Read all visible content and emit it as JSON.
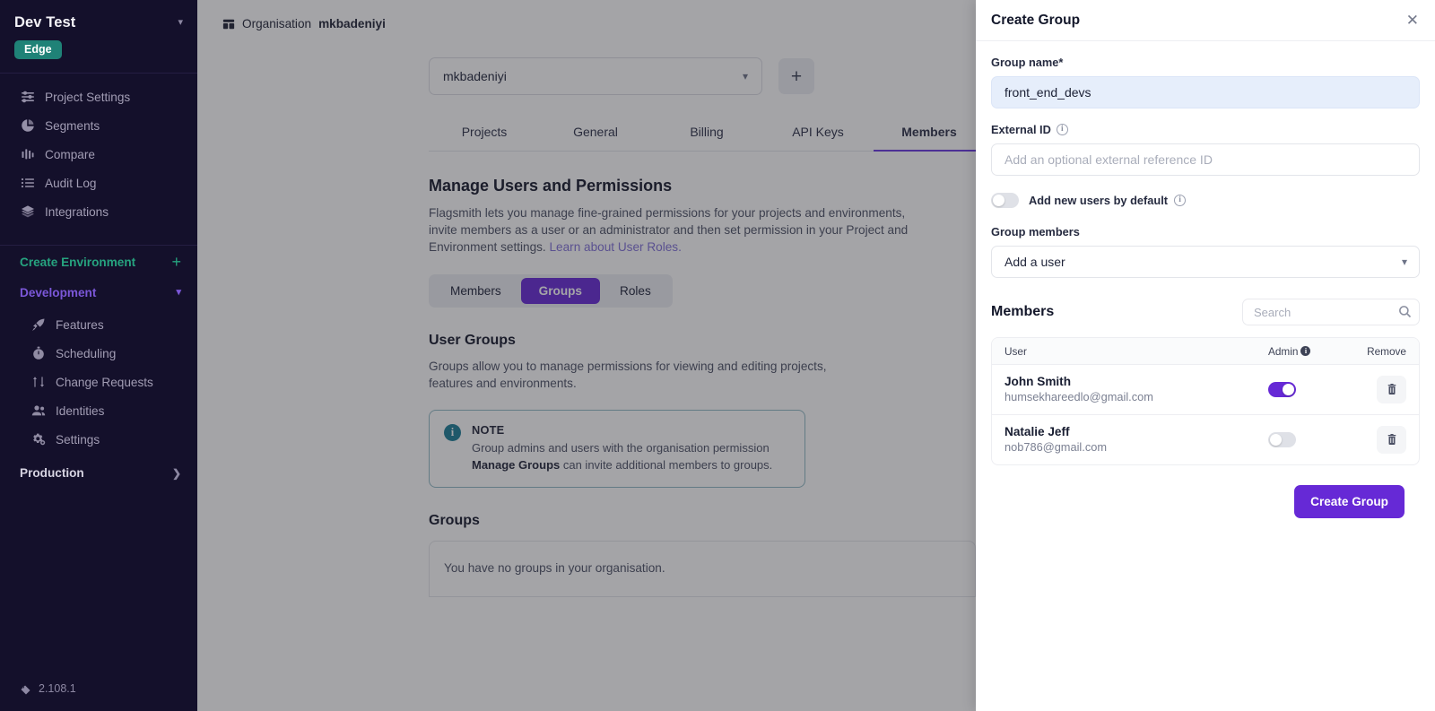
{
  "sidebar": {
    "project_name": "Dev Test",
    "project_chevron": "chevron-down",
    "edge_badge": "Edge",
    "project_items": [
      {
        "label": "Project Settings",
        "icon": "sliders-icon"
      },
      {
        "label": "Segments",
        "icon": "pie-chart-icon"
      },
      {
        "label": "Compare",
        "icon": "bar-chart-icon"
      },
      {
        "label": "Audit Log",
        "icon": "list-icon"
      },
      {
        "label": "Integrations",
        "icon": "layers-icon"
      }
    ],
    "create_environment": "Create Environment",
    "create_environment_plus": "+",
    "development": "Development",
    "development_items": [
      {
        "label": "Features",
        "icon": "rocket-icon"
      },
      {
        "label": "Scheduling",
        "icon": "stopwatch-icon"
      },
      {
        "label": "Change Requests",
        "icon": "git-branch-icon"
      },
      {
        "label": "Identities",
        "icon": "users-icon"
      },
      {
        "label": "Settings",
        "icon": "gears-icon"
      }
    ],
    "production": "Production",
    "version": "2.108.1"
  },
  "breadcrumb": {
    "icon": "organisation-icon",
    "prefix": "Organisation",
    "name": "mkbadeniyi"
  },
  "main": {
    "org_select_value": "mkbadeniyi",
    "org_add_label": "+",
    "tabs": [
      {
        "label": "Projects",
        "active": false
      },
      {
        "label": "General",
        "active": false
      },
      {
        "label": "Billing",
        "active": false
      },
      {
        "label": "API Keys",
        "active": false
      },
      {
        "label": "Members",
        "active": true
      }
    ],
    "manage_title": "Manage Users and Permissions",
    "manage_body_1": "Flagsmith lets you manage fine-grained permissions for your projects and environments, invite members as a user or an administrator and then set permission in your Project and Environment settings. ",
    "manage_link": "Learn about User Roles.",
    "segments": [
      {
        "label": "Members",
        "active": false
      },
      {
        "label": "Groups",
        "active": true
      },
      {
        "label": "Roles",
        "active": false
      }
    ],
    "user_groups_title": "User Groups",
    "user_groups_body": "Groups allow you to manage permissions for viewing and editing projects, features and environments.",
    "note": {
      "icon": "info-icon",
      "title": "NOTE",
      "body_1": "Group admins and users with the organisation permission ",
      "body_bold": "Manage Groups",
      "body_2": " can invite additional members to groups."
    },
    "groups_title": "Groups",
    "groups_empty": "You have no groups in your organisation."
  },
  "panel": {
    "title": "Create Group",
    "close_icon": "close-icon",
    "group_name_label": "Group name*",
    "group_name_value": "front_end_devs",
    "external_id_label": "External ID",
    "external_id_placeholder": "Add an optional external reference ID",
    "external_id_value": "",
    "add_new_users_label": "Add new users by default",
    "add_new_users_enabled": false,
    "group_members_label": "Group members",
    "add_user_select_value": "Add a user",
    "members_heading": "Members",
    "search_placeholder": "Search",
    "search_value": "",
    "table": {
      "columns": [
        "User",
        "Admin",
        "Remove"
      ],
      "rows": [
        {
          "name": "John Smith",
          "email": "humsekhareedlo@gmail.com",
          "admin": true,
          "remove_icon": "trash-icon"
        },
        {
          "name": "Natalie Jeff",
          "email": "nob786@gmail.com",
          "admin": false,
          "remove_icon": "trash-icon"
        }
      ]
    },
    "submit_label": "Create Group"
  },
  "colors": {
    "accent_purple": "#6629d6",
    "sidebar_bg": "#14102b",
    "edge_green": "#1f8277",
    "env_green": "#26a37f",
    "env_purple": "#7b57d8",
    "note_border": "#8fb9c4",
    "note_icon": "#1b7d97",
    "focus_field_bg": "#e6eefb"
  }
}
